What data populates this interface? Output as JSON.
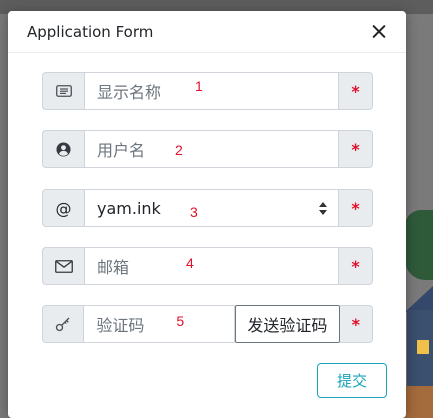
{
  "dialog": {
    "title": "Application Form",
    "submit_label": "提交"
  },
  "form": {
    "display_name": {
      "placeholder": "显示名称",
      "marker": "1",
      "required": "*",
      "icon": "id-card-icon"
    },
    "username": {
      "placeholder": "用户名",
      "marker": "2",
      "required": "*",
      "icon": "user-circle-icon"
    },
    "domain": {
      "prefix": "@",
      "value": "yam.ink",
      "marker": "3",
      "required": "*"
    },
    "email": {
      "placeholder": "邮箱",
      "marker": "4",
      "required": "*",
      "icon": "envelope-icon"
    },
    "code": {
      "placeholder": "验证码",
      "marker": "5",
      "send_label": "发送验证码",
      "required": "*",
      "icon": "key-icon"
    }
  },
  "colors": {
    "accent": "#17a2b8",
    "required": "#e0102b",
    "addon_bg": "#e9ecef",
    "border": "#ced4da"
  }
}
